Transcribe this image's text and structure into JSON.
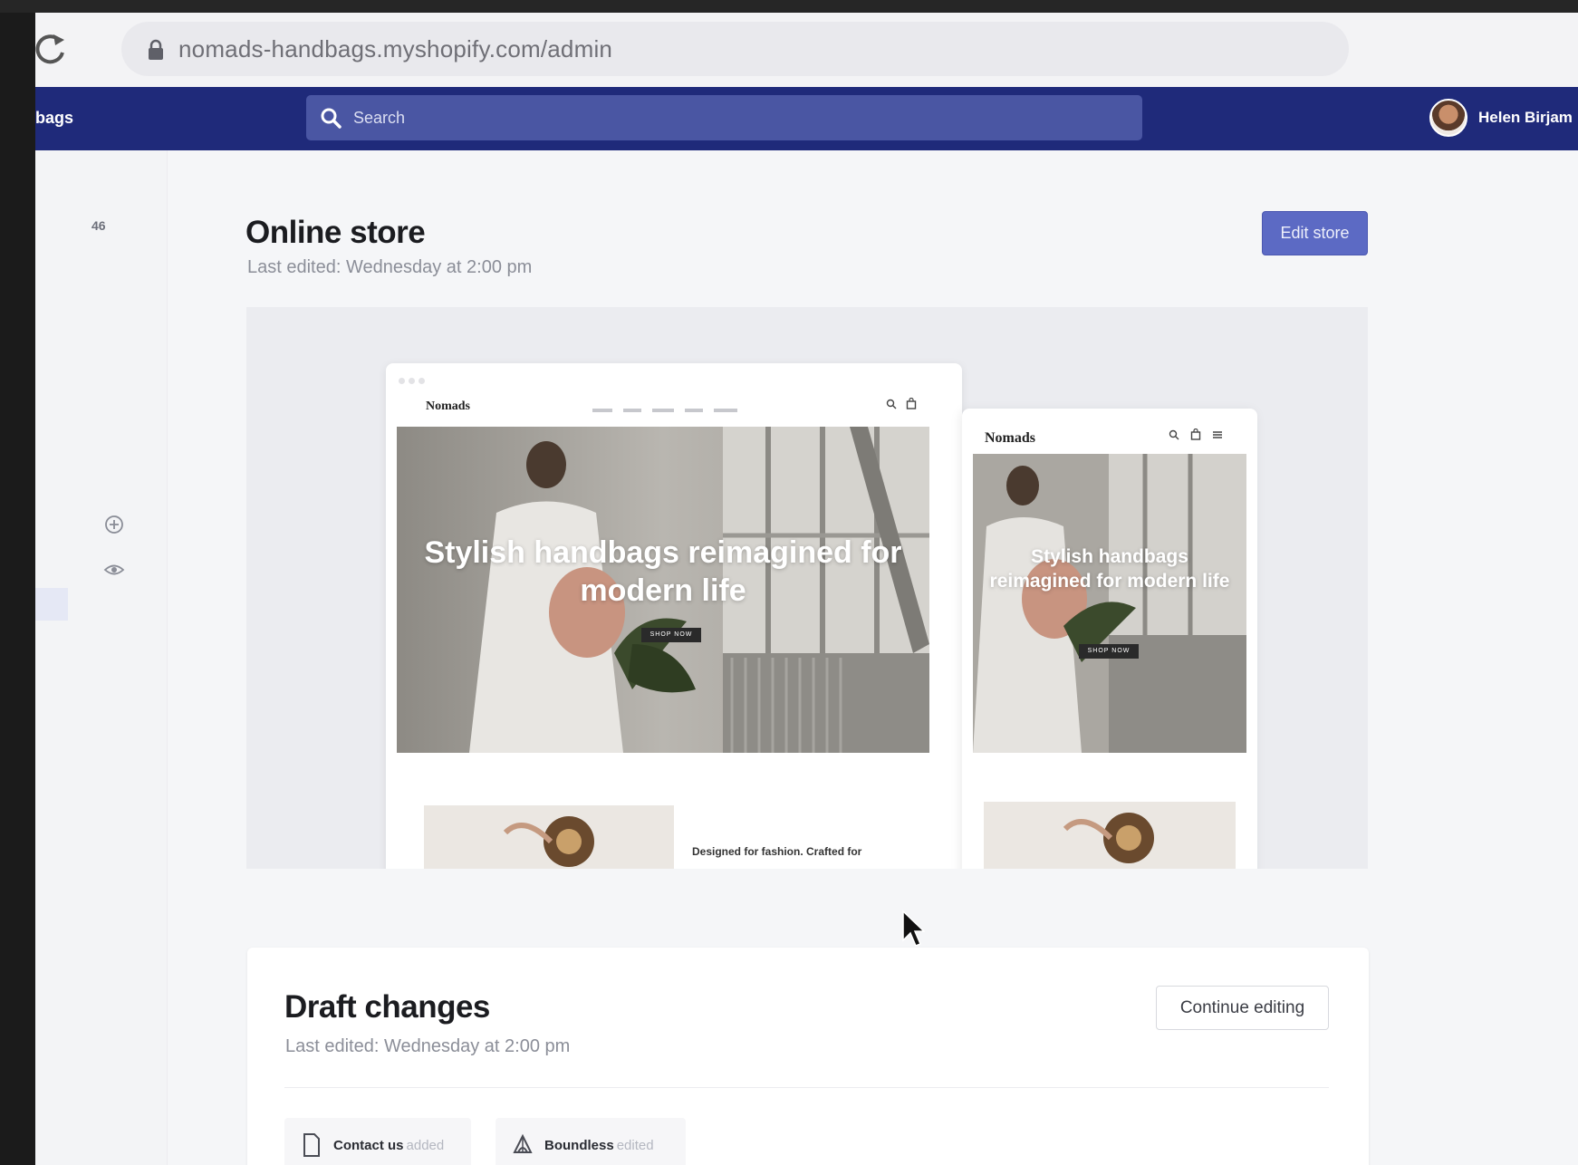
{
  "browser": {
    "url": "nomads-handbags.myshopify.com/admin"
  },
  "topbar": {
    "store_fragment": "bags",
    "search_placeholder": "Search",
    "user_name": "Helen Birjam"
  },
  "sidebar": {
    "badge": "46"
  },
  "online_store": {
    "title": "Online store",
    "subtitle": "Last edited: Wednesday at 2:00 pm",
    "edit_button": "Edit store"
  },
  "preview": {
    "desktop": {
      "logo": "Nomads",
      "hero_text": "Stylish handbags reimagined for modern life",
      "shop_button": "SHOP NOW",
      "caption": "Designed for fashion. Crafted for"
    },
    "mobile": {
      "logo": "Nomads",
      "hero_text": "Stylish handbags reimagined for modern life",
      "shop_button": "SHOP NOW"
    }
  },
  "draft": {
    "title": "Draft changes",
    "subtitle": "Last edited: Wednesday at 2:00 pm",
    "continue_button": "Continue editing",
    "changes": [
      {
        "label": "Contact us",
        "status": "added",
        "icon": "page-icon"
      },
      {
        "label": "Boundless",
        "status": "edited",
        "icon": "theme-icon"
      }
    ]
  },
  "colors": {
    "topbar": "#1f2a7a",
    "search": "#4a56a3",
    "primary_button": "#5c6ac4"
  }
}
